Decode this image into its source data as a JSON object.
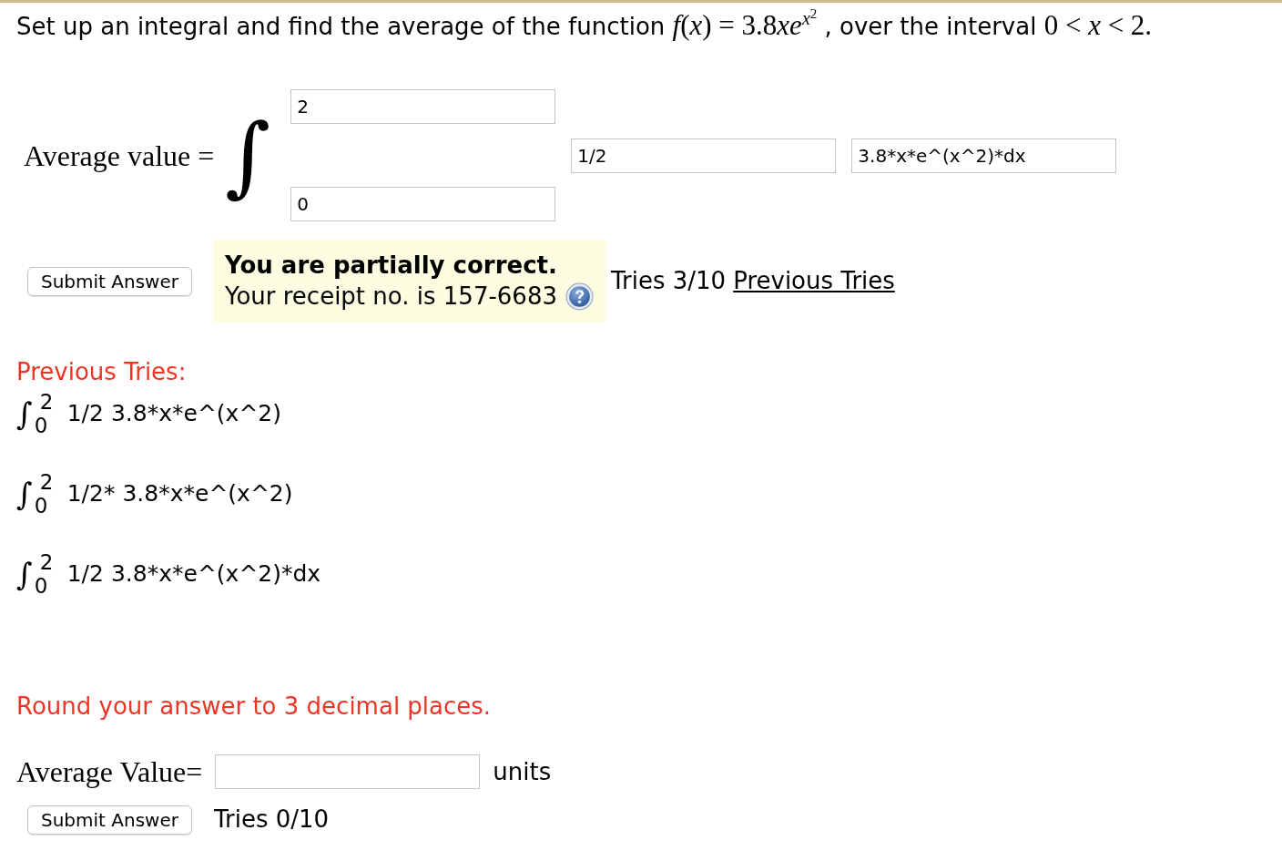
{
  "question": [
    {
      "kind": "text",
      "text": "Set up an integral and find the average of the function "
    },
    {
      "kind": "math",
      "text": "*f*(*x*) = 3.8"
    },
    {
      "kind": "variable",
      "text": "xe"
    },
    {
      "kind": "exponent",
      "text": "x",
      "power": "2"
    },
    {
      "kind": "text",
      "text": " , over the interval "
    },
    {
      "kind": "math",
      "text": "0 < *x* < 2."
    }
  ],
  "integral_setup": {
    "label": "Average value =",
    "symbol": "∫",
    "upper_limit": "2",
    "lower_limit": "0",
    "factor": "1/2",
    "integrand": "3.8*x*e^(x^2)*dx"
  },
  "first_submission": {
    "button": "Submit Answer",
    "feedback": {
      "title": "You are partially correct.",
      "receipt": "Your receipt no. is 157-6683"
    },
    "tries": "Tries 3/10",
    "previous_tries_link": "Previous Tries"
  },
  "previous_tries": {
    "heading": "Previous Tries:",
    "items": [
      {
        "symbol": "∫",
        "upper": "2",
        "lower": "0",
        "factor": "1/2",
        "expression": "3.8*x*e^(x^2)"
      },
      {
        "symbol": "∫",
        "upper": "2",
        "lower": "0",
        "factor": "1/2*",
        "expression": "3.8*x*e^(x^2)"
      },
      {
        "symbol": "∫",
        "upper": "2",
        "lower": "0",
        "factor": "1/2",
        "expression": "3.8*x*e^(x^2)*dx"
      }
    ]
  },
  "rounding_note": "Round your answer to 3 decimal places.",
  "answer": {
    "label": "Average Value=",
    "units": "units",
    "button": "Submit Answer",
    "tries": "Tries 0/10"
  }
}
